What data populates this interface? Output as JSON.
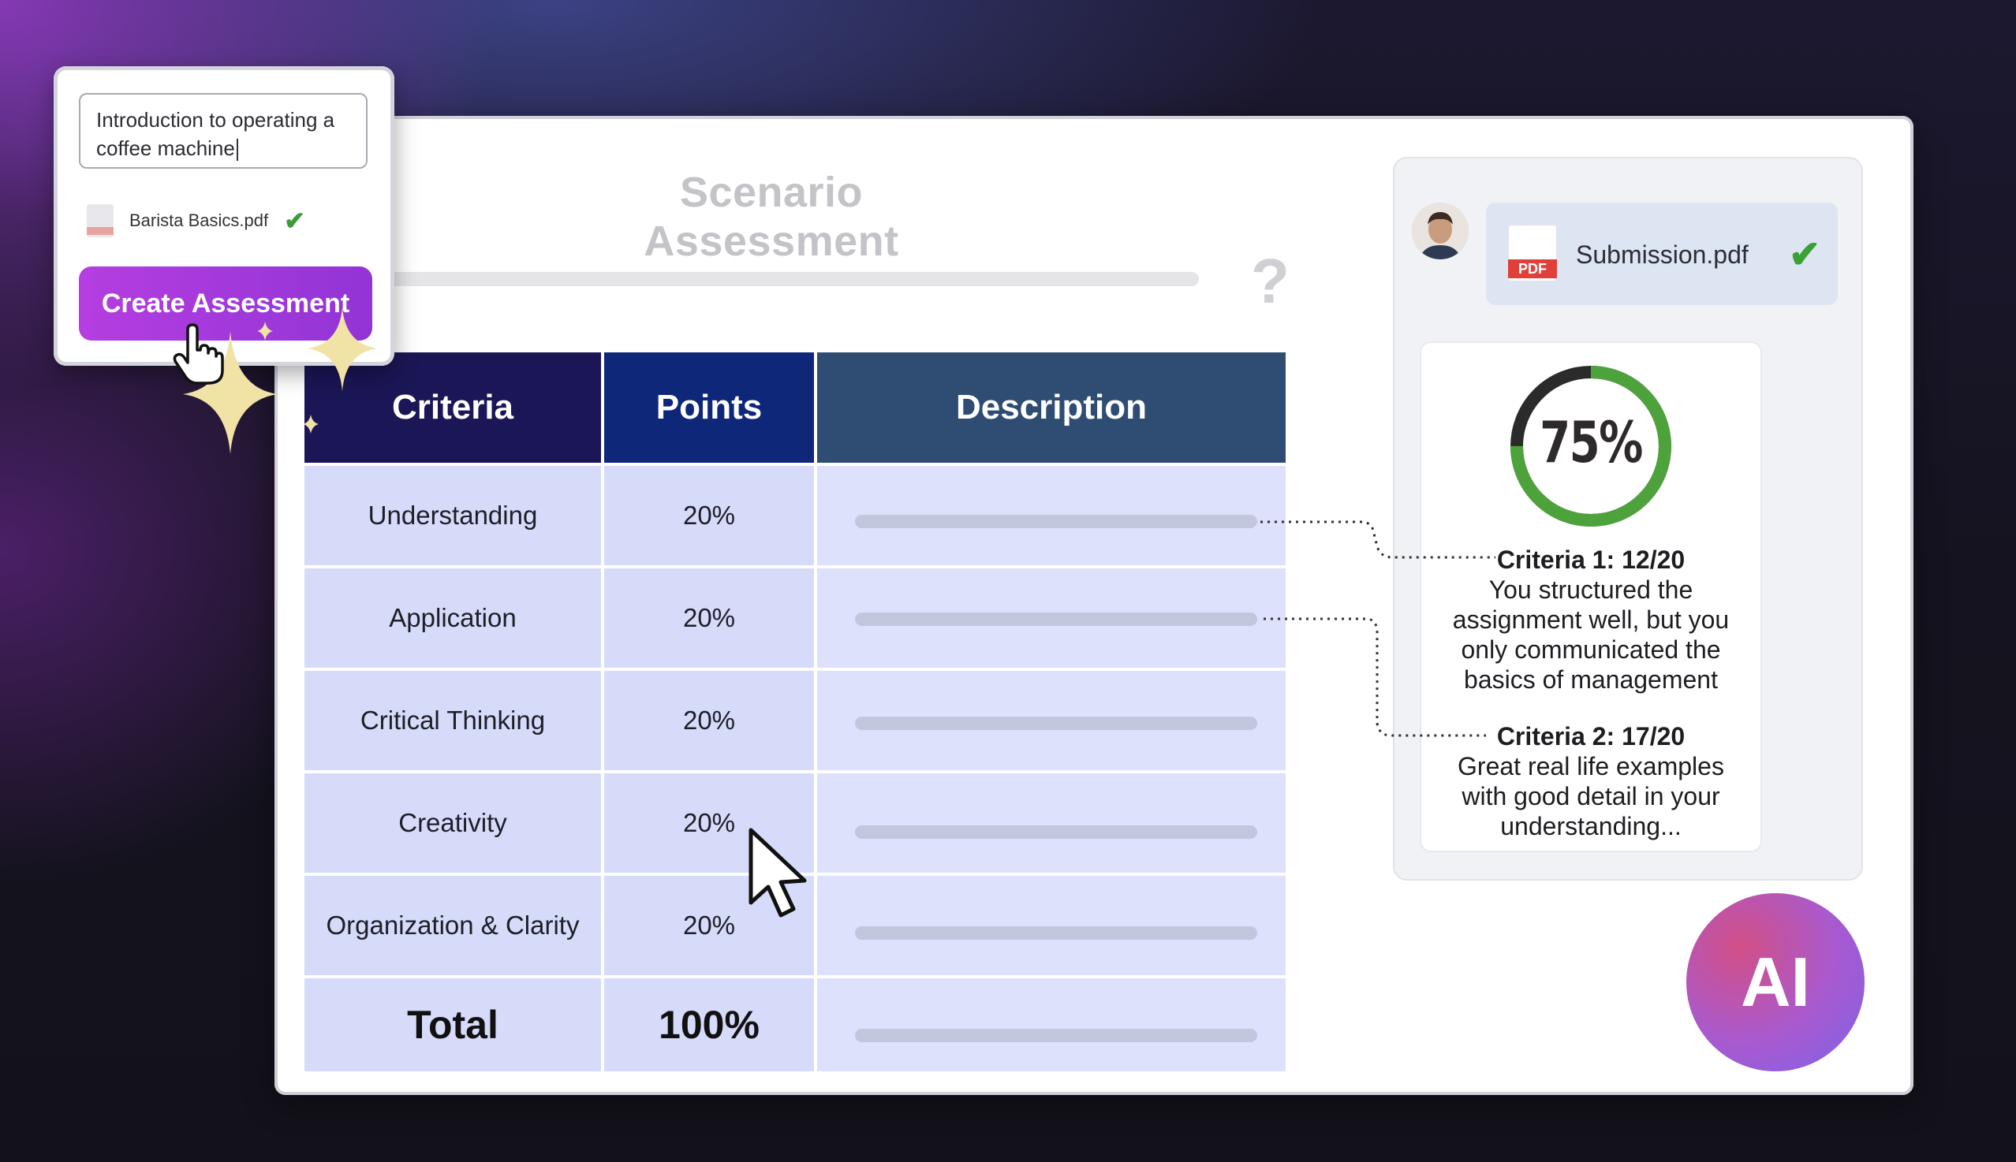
{
  "create_panel": {
    "topic_input_value": "Introduction to operating a coffee machine",
    "attached_file": "Barista Basics.pdf",
    "create_button_label": "Create Assessment"
  },
  "assessment": {
    "title": "Scenario Assessment",
    "question_mark": "?",
    "table": {
      "headers": [
        "Criteria",
        "Points",
        "Description"
      ],
      "rows": [
        {
          "criteria": "Understanding",
          "points": "20%"
        },
        {
          "criteria": "Application",
          "points": "20%"
        },
        {
          "criteria": "Critical Thinking",
          "points": "20%"
        },
        {
          "criteria": "Creativity",
          "points": "20%"
        },
        {
          "criteria": "Organization & Clarity",
          "points": "20%"
        }
      ],
      "total": {
        "label": "Total",
        "points": "100%"
      }
    }
  },
  "submission": {
    "file_name": "Submission.pdf",
    "file_tag": "PDF",
    "score_label": "75%",
    "score_fraction": 0.75,
    "feedback": [
      {
        "title": "Criteria 1: 12/20",
        "text": "You structured the assignment well, but you only communicated the basics of management"
      },
      {
        "title": "Criteria 2: 17/20",
        "text": "Great real life examples with good detail in your understanding..."
      }
    ]
  },
  "ai_badge_label": "AI",
  "colors": {
    "header_criteria": "#1b1656",
    "header_points": "#0f2778",
    "header_description": "#2f4d72",
    "row_fill": "#d6dbfa",
    "accent_purple": "#b53ee0",
    "ring_green": "#4ea23c",
    "check_green": "#3aa134"
  }
}
